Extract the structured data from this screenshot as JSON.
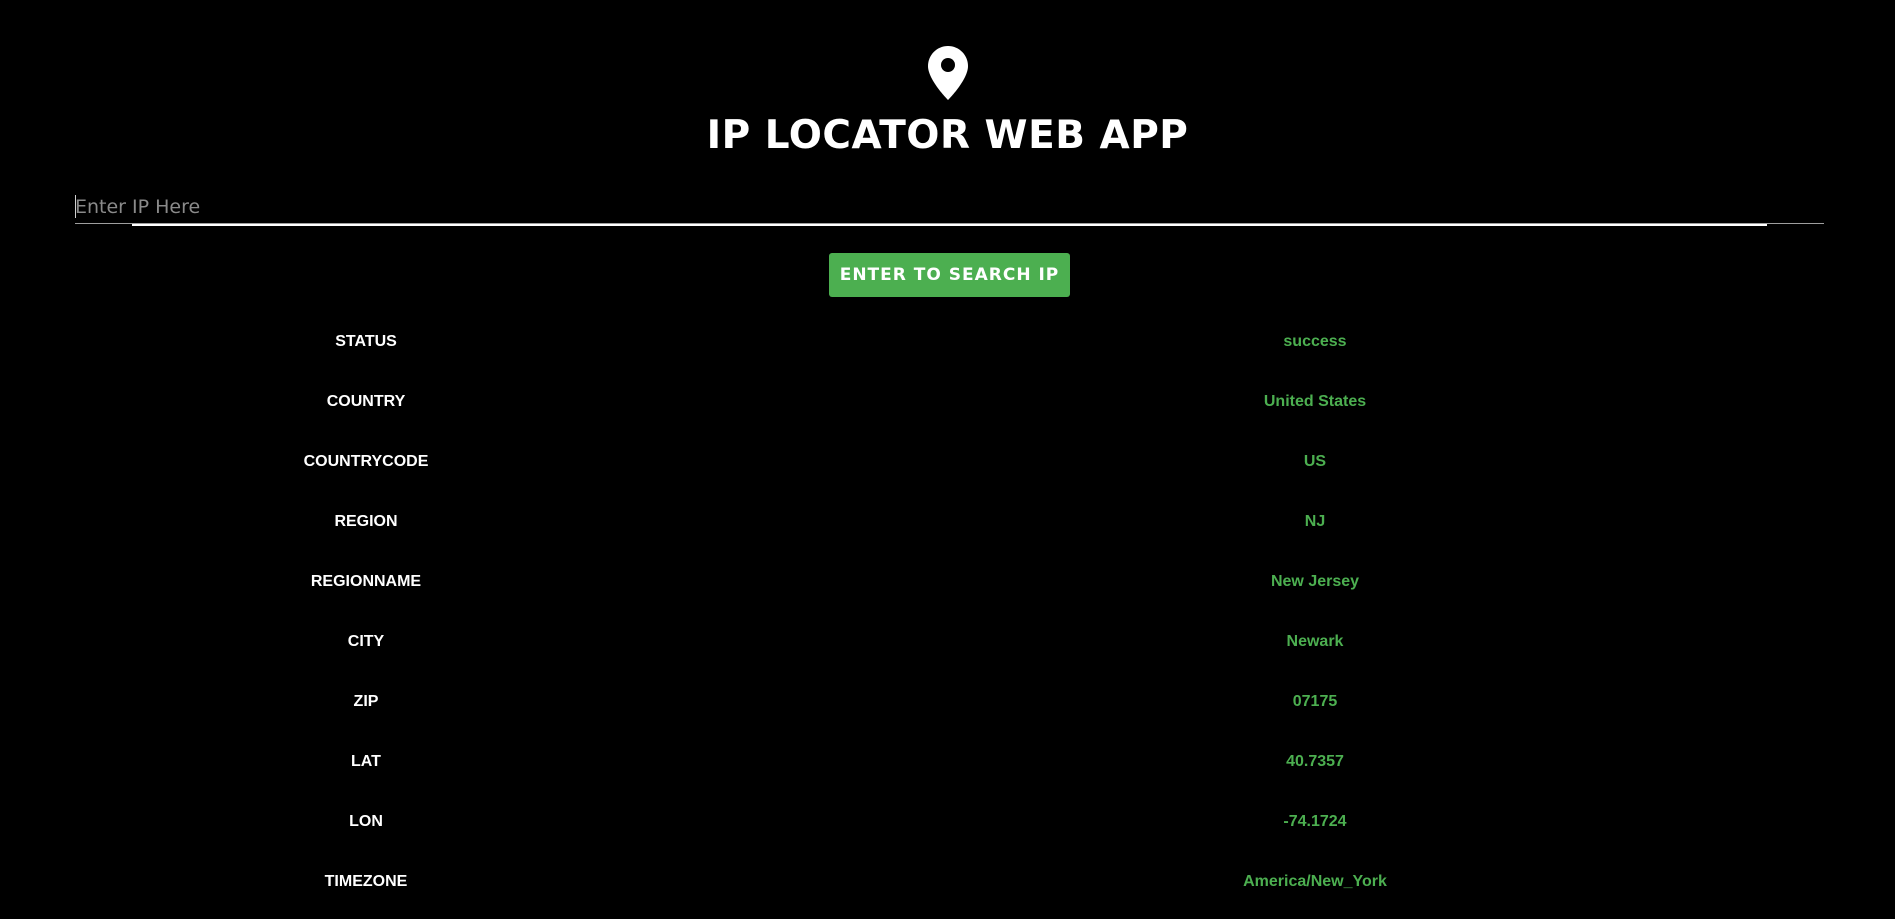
{
  "header": {
    "icon": "map-pin-icon",
    "title": "IP LOCATOR WEB APP"
  },
  "search": {
    "placeholder": "Enter IP Here",
    "value": "",
    "button_label": "ENTER TO SEARCH IP"
  },
  "colors": {
    "background": "#000000",
    "accent": "#4caf50",
    "text": "#ffffff"
  },
  "results": [
    {
      "key": "STATUS",
      "value": "success"
    },
    {
      "key": "COUNTRY",
      "value": "United States"
    },
    {
      "key": "COUNTRYCODE",
      "value": "US"
    },
    {
      "key": "REGION",
      "value": "NJ"
    },
    {
      "key": "REGIONNAME",
      "value": "New Jersey"
    },
    {
      "key": "CITY",
      "value": "Newark"
    },
    {
      "key": "ZIP",
      "value": "07175"
    },
    {
      "key": "LAT",
      "value": "40.7357"
    },
    {
      "key": "LON",
      "value": "-74.1724"
    },
    {
      "key": "TIMEZONE",
      "value": "America/New_York"
    }
  ]
}
